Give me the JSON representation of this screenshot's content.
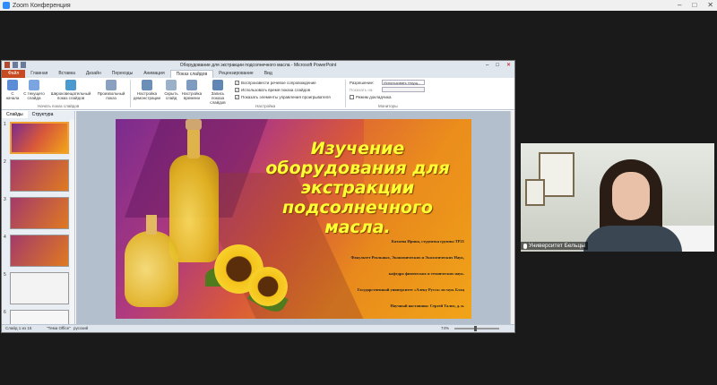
{
  "zoom": {
    "title": "Zoom Конференция"
  },
  "ppt": {
    "window_title": "Оборудование для экстракции подсолнечного масла - Microsoft PowerPoint",
    "tabs": [
      {
        "label": "Файл"
      },
      {
        "label": "Главная"
      },
      {
        "label": "Вставка"
      },
      {
        "label": "Дизайн"
      },
      {
        "label": "Переходы"
      },
      {
        "label": "Анимация"
      },
      {
        "label": "Показ слайдов"
      },
      {
        "label": "Рецензирование"
      },
      {
        "label": "Вид"
      }
    ],
    "ribbon": {
      "from_start": "С начала",
      "from_current": "С текущего слайда",
      "broadcast": "Широковещательный показ слайдов",
      "custom_show": "Произвольный показ",
      "group_start": "Начать показ слайдов",
      "setup": "Настройка демонстрации",
      "hide_slide": "Скрыть слайд",
      "rehearse": "Настройка времени",
      "record": "Запись показа слайдов",
      "chk_narration": "Воспроизвести речевое сопровождение",
      "chk_timings": "Использовать время показа слайдов",
      "chk_controls": "Показать элементы управления проигрывателя",
      "group_setup": "Настройка",
      "resolution_label": "Разрешение:",
      "resolution_value": "Использовать текущ...",
      "show_on_label": "Показать на:",
      "presenter_view": "Режим докладчика",
      "group_monitors": "Мониторы"
    },
    "pane_tabs": {
      "slides": "Слайды",
      "outline": "Структура"
    },
    "thumb_numbers": [
      "1",
      "2",
      "3",
      "4",
      "5",
      "6",
      "7"
    ],
    "status": {
      "slide_of": "Слайд 1 из 15",
      "theme": "\"Тема Office\"",
      "language": "русский",
      "zoom": "74%"
    }
  },
  "slide": {
    "title": "Изучение оборудования для экстракции подсолнечного масла.",
    "info": [
      "Катаева Ирина, студентка группы ТР21",
      "Факультет Реальных, Экономических и Экологических Наук,",
      "кафедра физических и технических наук.",
      "Государственный университет «Алеку Руссо» из мун. Бэлц",
      "Научный наставник: Сергей Талпэ, д. н."
    ]
  },
  "video": {
    "participant_name": "Университет Бельцы"
  },
  "colors": {
    "title_yellow": "#ffff33",
    "file_tab": "#c64b22",
    "zoom_blue": "#2d8cff"
  }
}
